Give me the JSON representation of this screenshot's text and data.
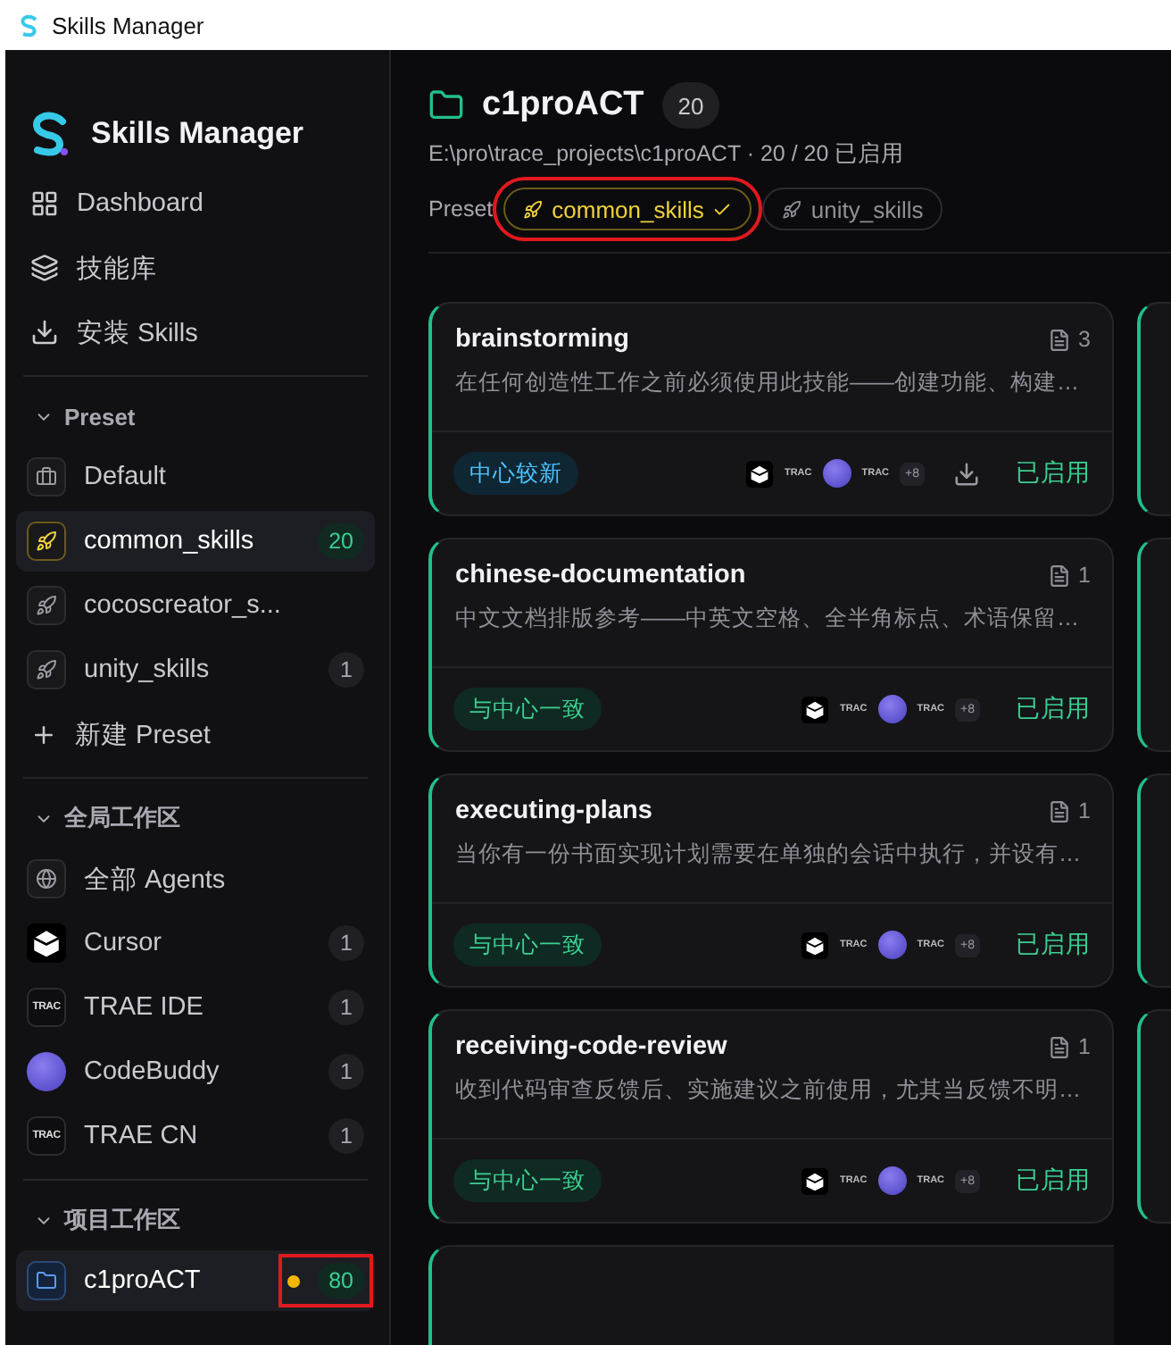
{
  "window": {
    "title": "Skills Manager"
  },
  "sidebar": {
    "brand": "Skills Manager",
    "nav": [
      {
        "kind": "grid",
        "label": "Dashboard"
      },
      {
        "kind": "layers",
        "label": "技能库"
      },
      {
        "kind": "download",
        "label": "安装 Skills"
      }
    ],
    "sections": [
      {
        "title": "Preset",
        "expanded": true,
        "items": [
          {
            "kind": "box",
            "label": "Default",
            "selected": false
          },
          {
            "kind": "rocket",
            "label": "common_skills",
            "count": "20",
            "selected": true
          },
          {
            "kind": "rocket",
            "label": "cocoscreator_s...",
            "selected": false
          },
          {
            "kind": "rocket",
            "label": "unity_skills",
            "count": "1",
            "selected": false
          }
        ],
        "add_label": "新建 Preset"
      },
      {
        "title": "全局工作区",
        "expanded": true,
        "items": [
          {
            "kind": "globe",
            "label": "全部 Agents",
            "selected": false
          },
          {
            "kind": "cursor",
            "label": "Cursor",
            "count": "1",
            "selected": false
          },
          {
            "kind": "trae",
            "logo": "TRAC",
            "label": "TRAE IDE",
            "count": "1",
            "selected": false
          },
          {
            "kind": "buddy",
            "label": "CodeBuddy",
            "count": "1",
            "selected": false
          },
          {
            "kind": "trae",
            "logo": "TRAC",
            "label": "TRAE CN",
            "count": "1",
            "selected": false
          }
        ]
      },
      {
        "title": "项目工作区",
        "expanded": true,
        "items": [
          {
            "kind": "folder",
            "label": "c1proACT",
            "count": "80",
            "color": "#f5b800",
            "highlighted": true,
            "selected": true
          }
        ]
      }
    ]
  },
  "project": {
    "name": "c1proACT",
    "count": "20",
    "path": "E:\\pro\\trace_projects\\c1proACT · 20 / 20 已启用",
    "preset_label": "Preset",
    "presets": [
      {
        "label": "common_skills",
        "selected": true,
        "highlighted": true
      },
      {
        "label": "unity_skills",
        "selected": false,
        "highlighted": false
      }
    ]
  },
  "cards": [
    {
      "name": "brainstorming",
      "files": "3",
      "description": "在任何创造性工作之前必须使用此技能——创建功能、构建…",
      "sync": {
        "kind": "newer",
        "label": "中心较新"
      },
      "agents": [
        {
          "kind": "cursor"
        },
        {
          "kind": "trae",
          "label": "TRAC"
        },
        {
          "kind": "buddy"
        },
        {
          "kind": "trae",
          "label": "TRAC"
        },
        {
          "kind": "more",
          "label": "+8"
        }
      ],
      "download": true,
      "status": "已启用"
    },
    {
      "name": "chinese-documentation",
      "files": "1",
      "description": "中文文档排版参考——中英文空格、全半角标点、术语保留…",
      "sync": {
        "kind": "synced",
        "label": "与中心一致"
      },
      "agents": [
        {
          "kind": "cursor"
        },
        {
          "kind": "trae",
          "label": "TRAC"
        },
        {
          "kind": "buddy"
        },
        {
          "kind": "trae",
          "label": "TRAC"
        },
        {
          "kind": "more",
          "label": "+8"
        }
      ],
      "download": false,
      "status": "已启用"
    },
    {
      "name": "executing-plans",
      "files": "1",
      "description": "当你有一份书面实现计划需要在单独的会话中执行，并设有…",
      "sync": {
        "kind": "synced",
        "label": "与中心一致"
      },
      "agents": [
        {
          "kind": "cursor"
        },
        {
          "kind": "trae",
          "label": "TRAC"
        },
        {
          "kind": "buddy"
        },
        {
          "kind": "trae",
          "label": "TRAC"
        },
        {
          "kind": "more",
          "label": "+8"
        }
      ],
      "download": false,
      "status": "已启用"
    },
    {
      "name": "receiving-code-review",
      "files": "1",
      "description": "收到代码审查反馈后、实施建议之前使用，尤其当反馈不明…",
      "sync": {
        "kind": "synced",
        "label": "与中心一致"
      },
      "agents": [
        {
          "kind": "cursor"
        },
        {
          "kind": "trae",
          "label": "TRAC"
        },
        {
          "kind": "buddy"
        },
        {
          "kind": "trae",
          "label": "TRAC"
        },
        {
          "kind": "more",
          "label": "+8"
        }
      ],
      "download": false,
      "status": "已启用"
    }
  ]
}
